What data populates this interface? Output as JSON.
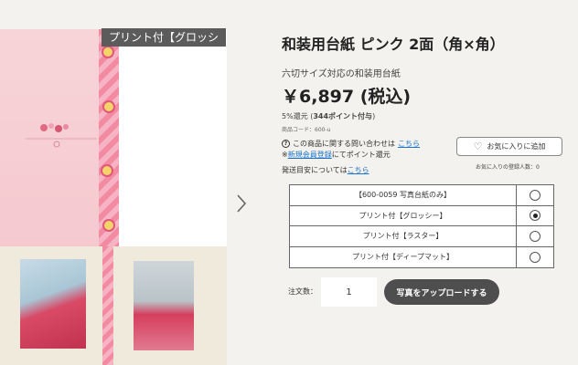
{
  "gallery": {
    "badge": "プリント付【グロッシー】",
    "next_icon": "chevron-right-icon"
  },
  "product": {
    "title": "和装用台紙 ピンク 2面（角×角）",
    "subtitle": "六切サイズ対応の和装用台紙",
    "price": "￥6,897 (税込)",
    "points_prefix": "5%還元 (",
    "points_bold": "344ポイント付与",
    "points_suffix": ")",
    "code": "商品コード：600-u",
    "inquiry_text": "この商品に関する問い合わせは",
    "inquiry_link": "こちら",
    "register_prefix": "※",
    "register_link": "新規会員登録",
    "register_suffix": "にてポイント還元",
    "shipping_text": "発送目安については",
    "shipping_link": "こちら"
  },
  "favorite": {
    "button_label": "お気に入りに追加",
    "icon": "heart-icon",
    "count_text": "お気に入りの登録人数：0"
  },
  "options": [
    {
      "label": "【600-0059 写真台紙のみ】",
      "selected": false
    },
    {
      "label": "プリント付【グロッシー】",
      "selected": true
    },
    {
      "label": "プリント付【ラスター】",
      "selected": false
    },
    {
      "label": "プリント付【ディープマット】",
      "selected": false
    }
  ],
  "order": {
    "quantity_label": "注文数：",
    "quantity_value": "1",
    "upload_button": "写真をアップロードする"
  },
  "colors": {
    "background": "#f4f2ee",
    "button_dark": "#4e4e4e",
    "link": "#1a73c8",
    "badge": "#5b5b5b",
    "pink": "#f7d4d8"
  }
}
